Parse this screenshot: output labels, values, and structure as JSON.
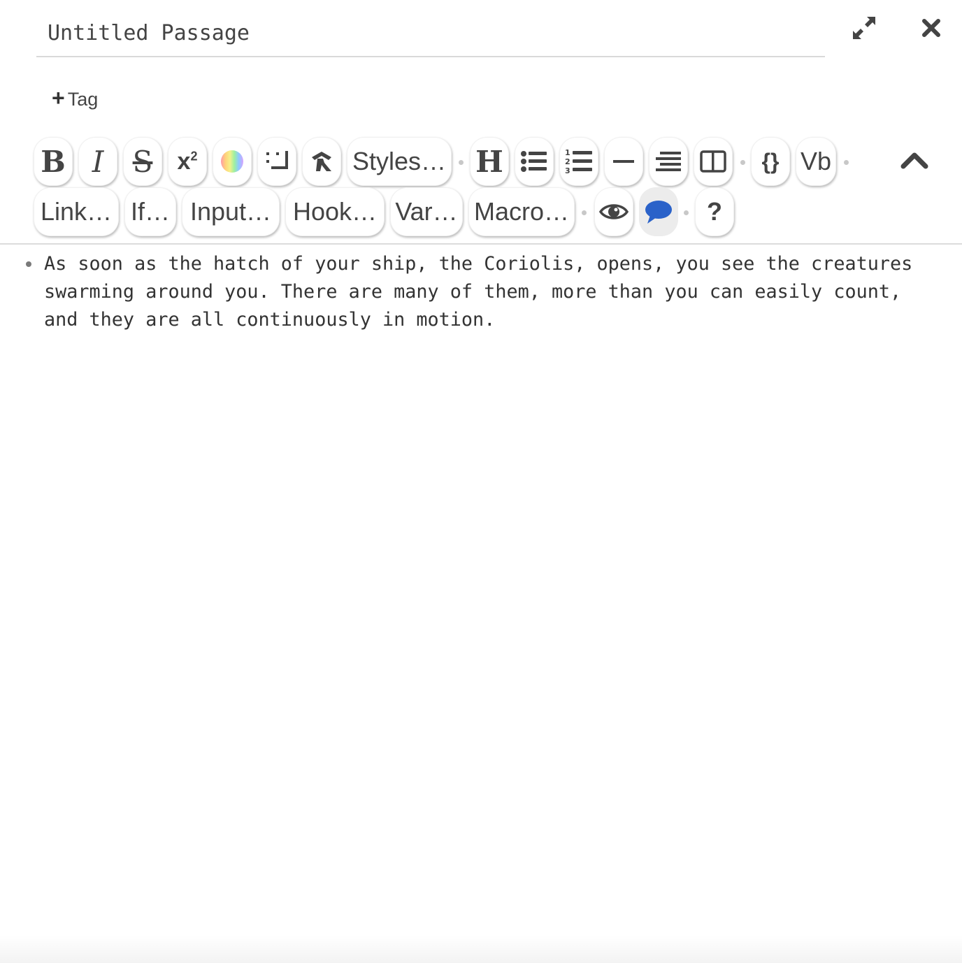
{
  "passage": {
    "title_value": "Untitled Passage"
  },
  "header": {
    "expand_icon": "expand-arrows-icon",
    "close_icon": "close-x-icon"
  },
  "tags": {
    "add_label": "Tag"
  },
  "toolbar": {
    "bold_label": "B",
    "italic_label": "I",
    "strike_label": "S",
    "superscript_label": "x",
    "superscript_exp": "2",
    "styles_label": "Styles…",
    "heading_label": "H",
    "code_label": "{}",
    "verbatim_label": "Vb",
    "link_label": "Link…",
    "if_label": "If…",
    "input_label": "Input…",
    "hook_label": "Hook…",
    "var_label": "Var…",
    "macro_label": "Macro…",
    "help_label": "?",
    "colors": {
      "comment_active": "#2a62c9"
    }
  },
  "editor": {
    "bullet_text": "As soon as the hatch of your ship, the Coriolis, opens, you see the creatures swarming around you. There are many of them, more than you can easily count, and they are all continuously in motion."
  }
}
